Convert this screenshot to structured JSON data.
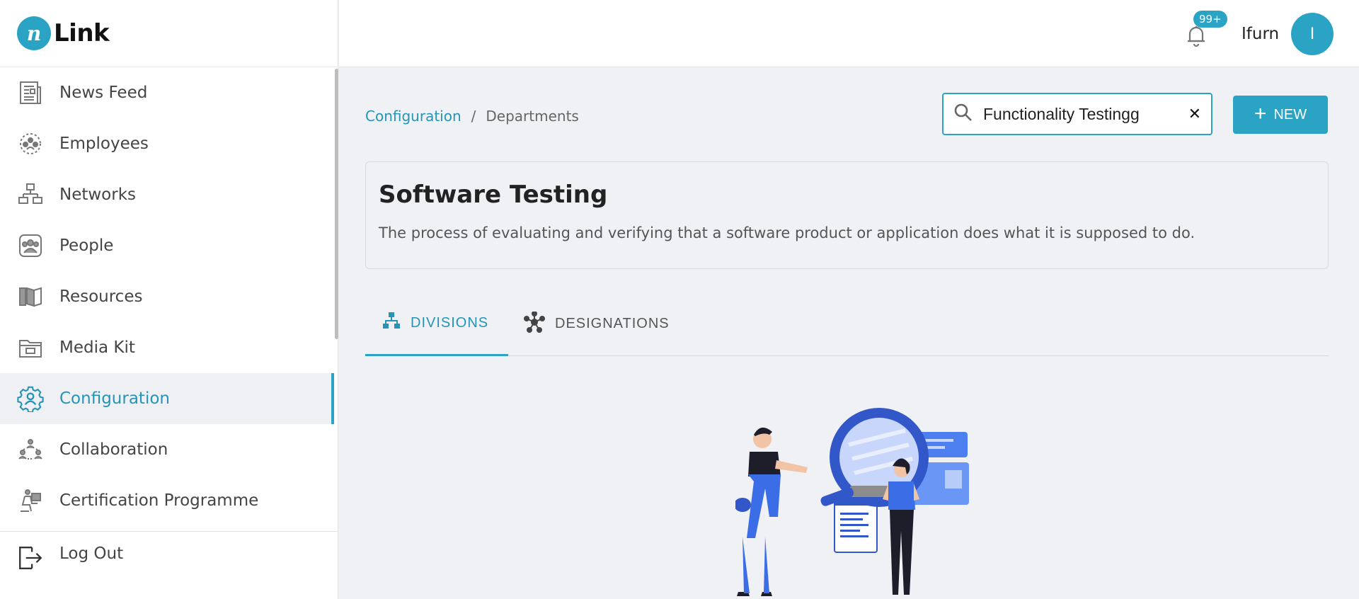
{
  "app": {
    "logo_letter": "n",
    "logo_text": "Link"
  },
  "sidebar": {
    "items": [
      {
        "label": "News Feed",
        "icon": "newspaper-icon"
      },
      {
        "label": "Employees",
        "icon": "employees-icon"
      },
      {
        "label": "Networks",
        "icon": "network-icon"
      },
      {
        "label": "People",
        "icon": "people-icon"
      },
      {
        "label": "Resources",
        "icon": "book-icon"
      },
      {
        "label": "Media Kit",
        "icon": "folder-icon"
      },
      {
        "label": "Configuration",
        "icon": "gear-icon",
        "active": true
      },
      {
        "label": "Collaboration",
        "icon": "collaboration-icon"
      },
      {
        "label": "Certification Programme",
        "icon": "certification-icon"
      }
    ],
    "logout_label": "Log Out"
  },
  "header": {
    "notification_count": "99+",
    "username": "Ifurn",
    "avatar_initial": "I"
  },
  "breadcrumb": {
    "parent": "Configuration",
    "separator": "/",
    "current": "Departments"
  },
  "search": {
    "value": "Functionality Testingg",
    "clear_symbol": "✕"
  },
  "new_button": {
    "label": "NEW",
    "plus": "+"
  },
  "department": {
    "title": "Software Testing",
    "description": "The process of evaluating and verifying that a software product or application does what it is supposed to do."
  },
  "tabs": [
    {
      "label": "DIVISIONS",
      "icon": "hierarchy-icon",
      "active": true
    },
    {
      "label": "DESIGNATIONS",
      "icon": "molecule-icon",
      "active": false
    }
  ],
  "colors": {
    "accent": "#2aa3c4",
    "accent_text": "#2594b7",
    "background": "#f0f1f5"
  }
}
